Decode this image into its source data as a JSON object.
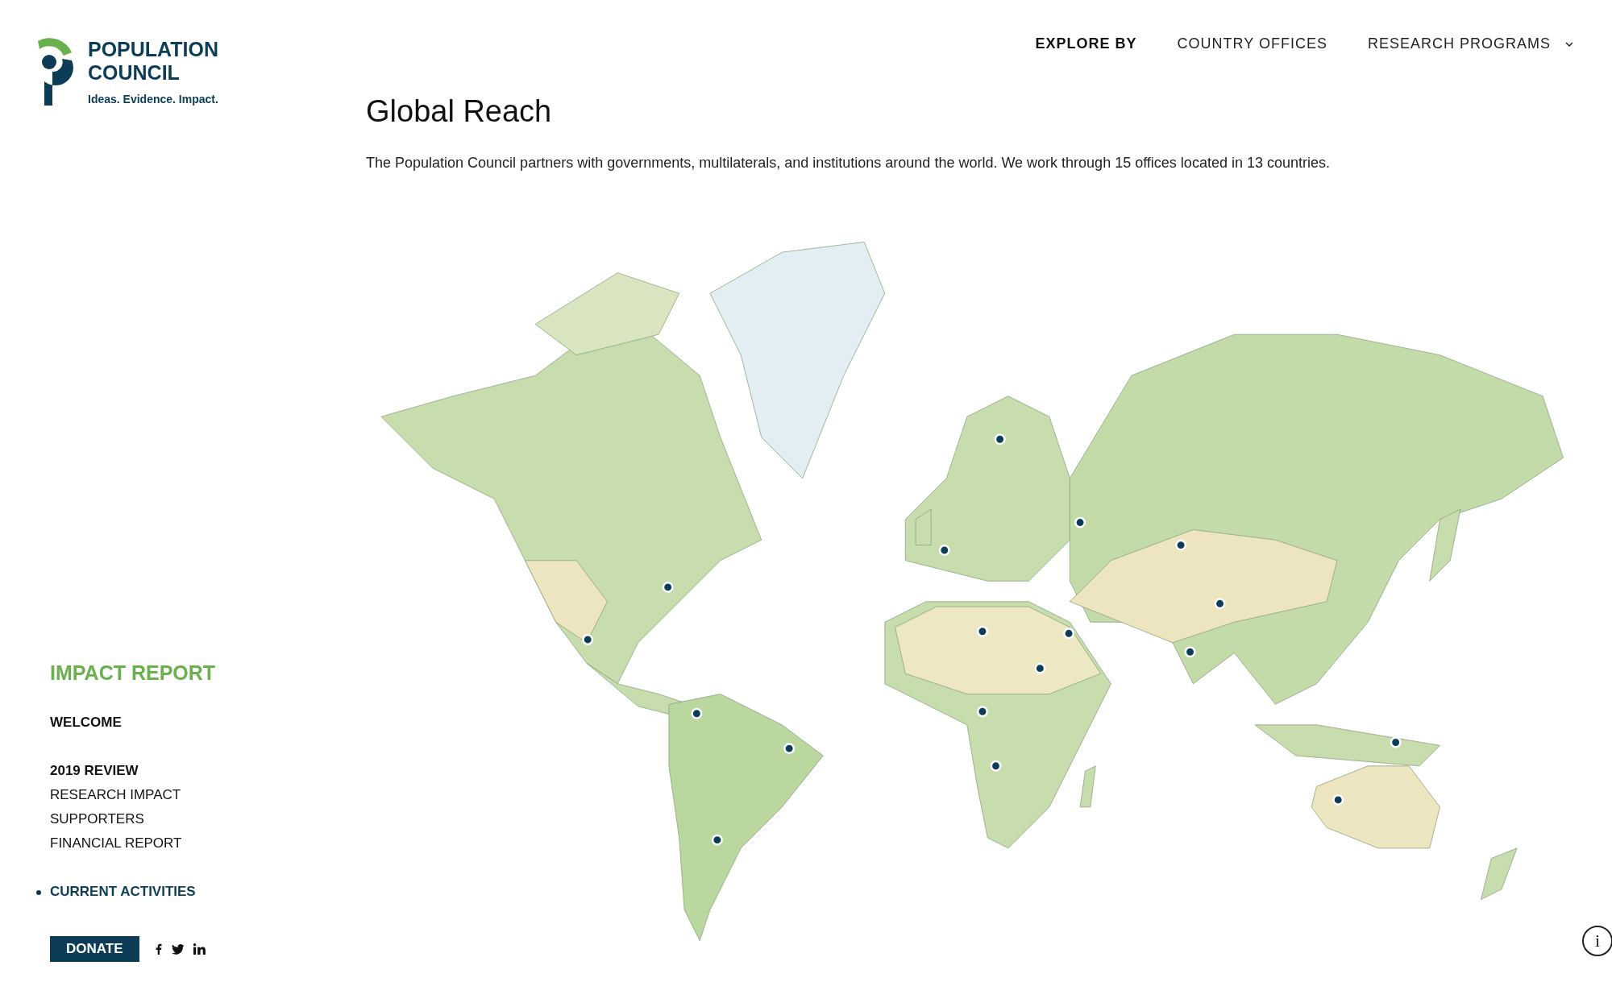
{
  "logo": {
    "name_lines": [
      "POPULATION",
      "COUNCIL"
    ],
    "tagline": "Ideas. Evidence. Impact."
  },
  "nav": {
    "label": "EXPLORE BY",
    "items": [
      {
        "label": "COUNTRY OFFICES",
        "has_dropdown": false
      },
      {
        "label": "RESEARCH PROGRAMS",
        "has_dropdown": true
      }
    ]
  },
  "page": {
    "title": "Global Reach",
    "intro": "The Population Council partners with governments, multilaterals, and institutions around the world.  We work through 15 offices located in 13 countries."
  },
  "sidebar": {
    "heading": "IMPACT REPORT",
    "items": [
      {
        "label": "WELCOME",
        "kind": "section",
        "selected": false
      },
      {
        "label": "2019 REVIEW",
        "kind": "section",
        "selected": false
      },
      {
        "label": "RESEARCH IMPACT",
        "kind": "page",
        "selected": false
      },
      {
        "label": "SUPPORTERS",
        "kind": "page",
        "selected": false
      },
      {
        "label": "FINANCIAL REPORT",
        "kind": "page",
        "selected": false
      },
      {
        "label": "CURRENT ACTIVITIES",
        "kind": "section",
        "selected": true
      }
    ],
    "donate": "DONATE"
  },
  "info_button": "i"
}
